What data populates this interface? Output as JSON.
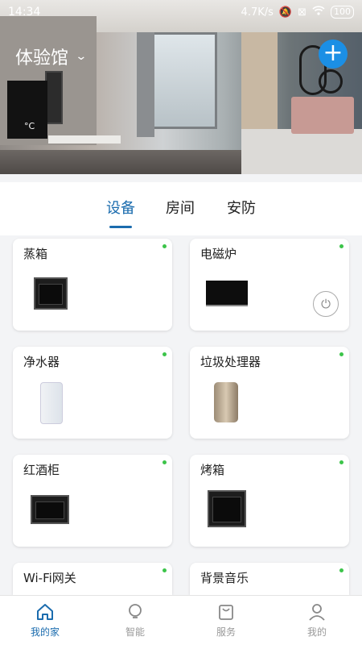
{
  "status": {
    "time": "14:34",
    "speed": "4.7K/s",
    "battery": "100"
  },
  "header": {
    "house_name": "体验馆",
    "temperature_unit": "°C"
  },
  "tabs": [
    {
      "label": "设备",
      "active": true
    },
    {
      "label": "房间",
      "active": false
    },
    {
      "label": "安防",
      "active": false
    }
  ],
  "devices": [
    {
      "name": "蒸箱",
      "online": true
    },
    {
      "name": "电磁炉",
      "online": true
    },
    {
      "name": "净水器",
      "online": true
    },
    {
      "name": "垃圾处理器",
      "online": true
    },
    {
      "name": "红酒柜",
      "online": true
    },
    {
      "name": "烤箱",
      "online": true
    },
    {
      "name": "Wi-Fi网关",
      "online": true
    },
    {
      "name": "背景音乐",
      "online": true
    }
  ],
  "nav": [
    {
      "label": "我的家",
      "icon": "home-icon",
      "active": true
    },
    {
      "label": "智能",
      "icon": "bulb-icon",
      "active": false
    },
    {
      "label": "服务",
      "icon": "bag-icon",
      "active": false
    },
    {
      "label": "我的",
      "icon": "user-icon",
      "active": false
    }
  ],
  "colors": {
    "accent": "#1b6cae",
    "add_button": "#1b8fe5",
    "online_dot": "#3cc44a"
  }
}
